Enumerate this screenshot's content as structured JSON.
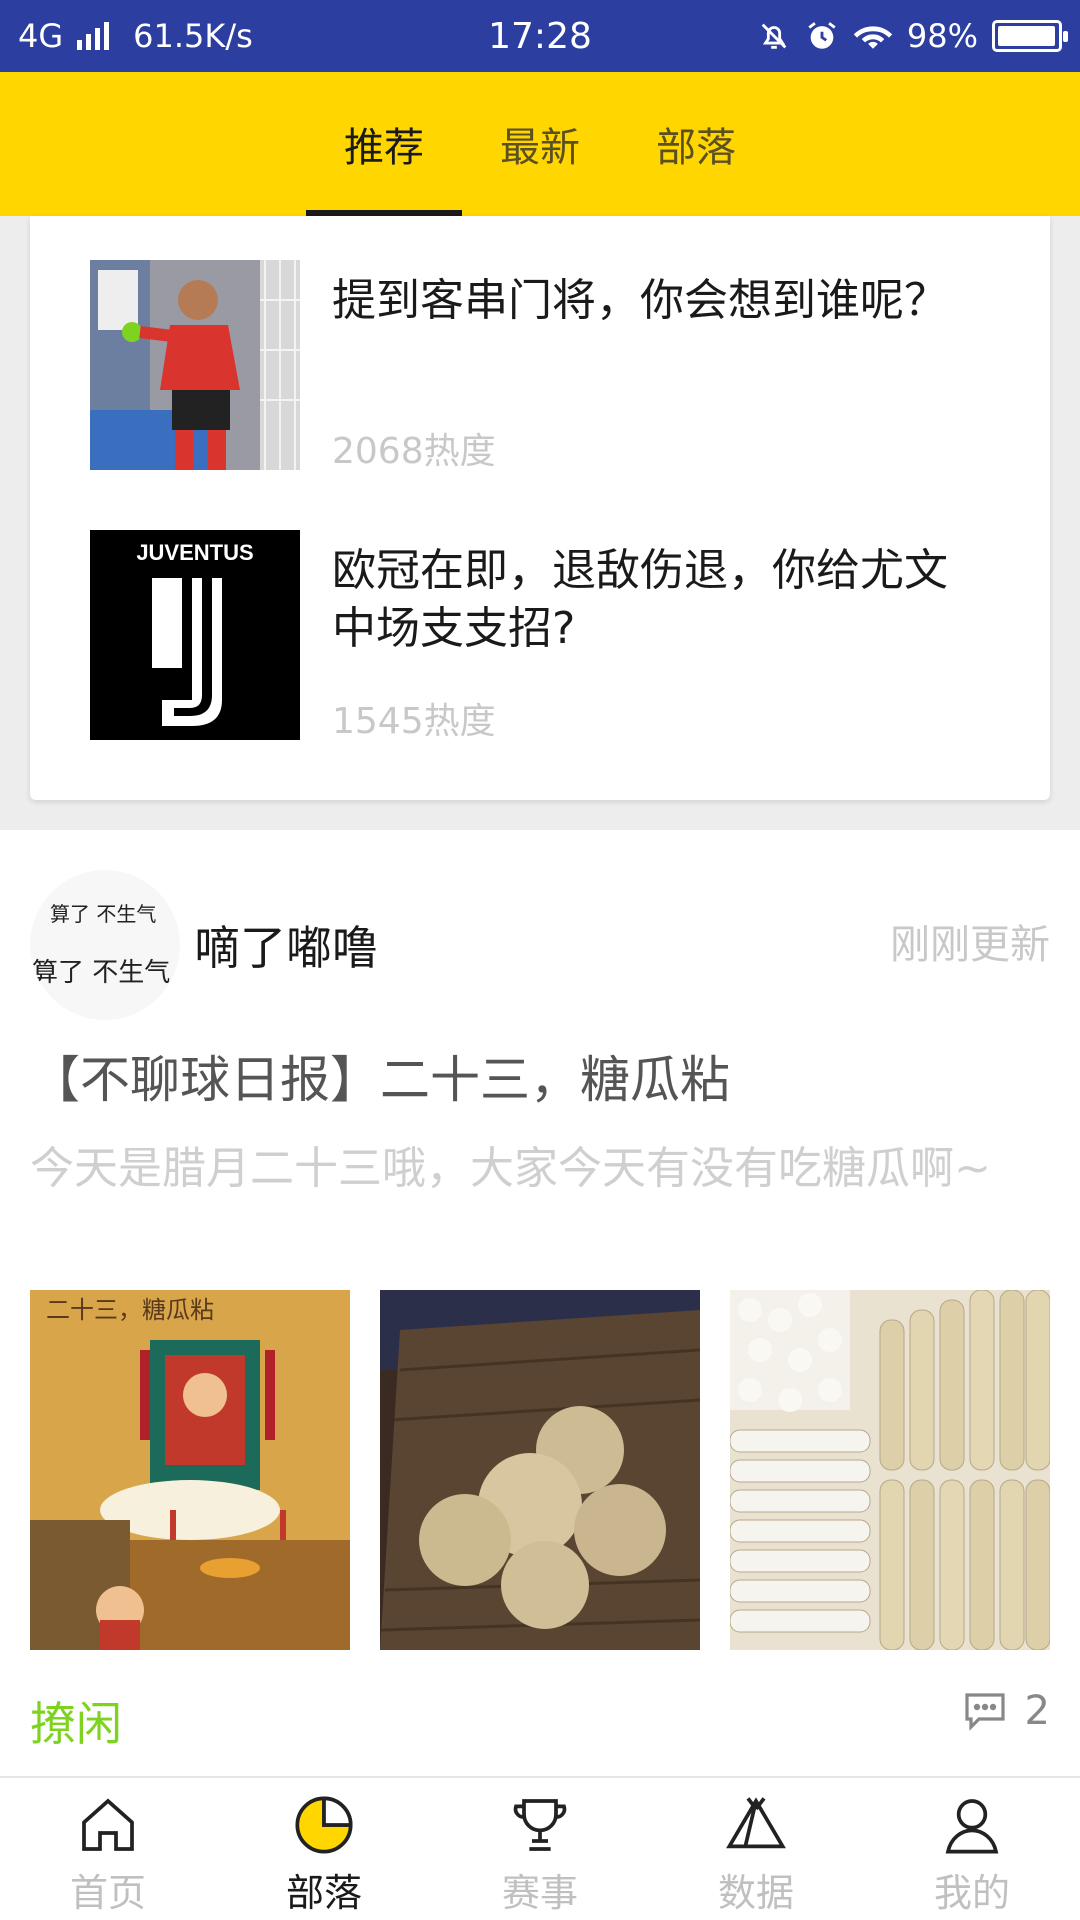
{
  "status_bar": {
    "network": "4G",
    "speed": "61.5K/s",
    "time": "17:28",
    "battery": "98%",
    "battery_level": 0.98,
    "icons": [
      "signal-icon",
      "mute-icon",
      "alarm-icon",
      "wifi-icon",
      "battery-icon"
    ]
  },
  "top_tabs": [
    {
      "label": "推荐",
      "active": true
    },
    {
      "label": "最新",
      "active": false
    },
    {
      "label": "部落",
      "active": false
    }
  ],
  "recommended": [
    {
      "title": "提到客串门将，你会想到谁呢？",
      "heat": "2068热度"
    },
    {
      "title": "欧冠在即，退敌伤退，你给尤文中场支支招?",
      "heat": "1545热度",
      "logo_text": "JUVENTUS"
    }
  ],
  "post": {
    "avatar_text_top": "算了 不生气",
    "avatar_text_main": "算了 不生气",
    "author": "嘀了嘟噜",
    "updated": "刚刚更新",
    "title": "【不聊球日报】二十三，糖瓜粘",
    "summary": "今天是腊月二十三哦，大家今天有没有吃糖瓜啊~",
    "image1_caption": "二十三，糖瓜粘",
    "tag": "撩闲",
    "comment_count": "2"
  },
  "bottom_nav": [
    {
      "label": "首页",
      "icon": "home-icon",
      "active": false
    },
    {
      "label": "部落",
      "icon": "tribe-pie-icon",
      "active": true
    },
    {
      "label": "赛事",
      "icon": "trophy-icon",
      "active": false
    },
    {
      "label": "数据",
      "icon": "tent-icon",
      "active": false
    },
    {
      "label": "我的",
      "icon": "profile-icon",
      "active": false
    }
  ],
  "colors": {
    "status_bar": "#2c3ea0",
    "header": "#ffd600",
    "tag_green": "#7ed321",
    "active_nav_yellow": "#ffd600"
  }
}
